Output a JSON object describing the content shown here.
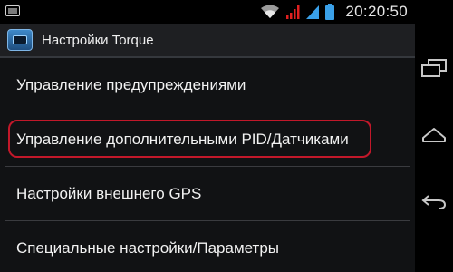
{
  "status_bar": {
    "time": "20:20:50",
    "icons": [
      "notification-icon",
      "wifi-icon",
      "signal-warning-icon",
      "signal-icon",
      "battery-icon"
    ]
  },
  "action_bar": {
    "title": "Настройки Torque",
    "app_icon": "torque-app-icon"
  },
  "settings_list": {
    "items": [
      {
        "label": "Управление предупреждениями"
      },
      {
        "label": "Управление дополнительными PID/Датчиками",
        "highlighted": true
      },
      {
        "label": "Настройки внешнего GPS"
      },
      {
        "label": "Специальные настройки/Параметры"
      }
    ]
  },
  "nav_bar": {
    "buttons": [
      "recent-apps-icon",
      "home-icon",
      "back-icon"
    ]
  },
  "colors": {
    "highlight_ring": "#c2182a",
    "warning_red": "#e02020",
    "signal_blue": "#3aa0e8"
  }
}
